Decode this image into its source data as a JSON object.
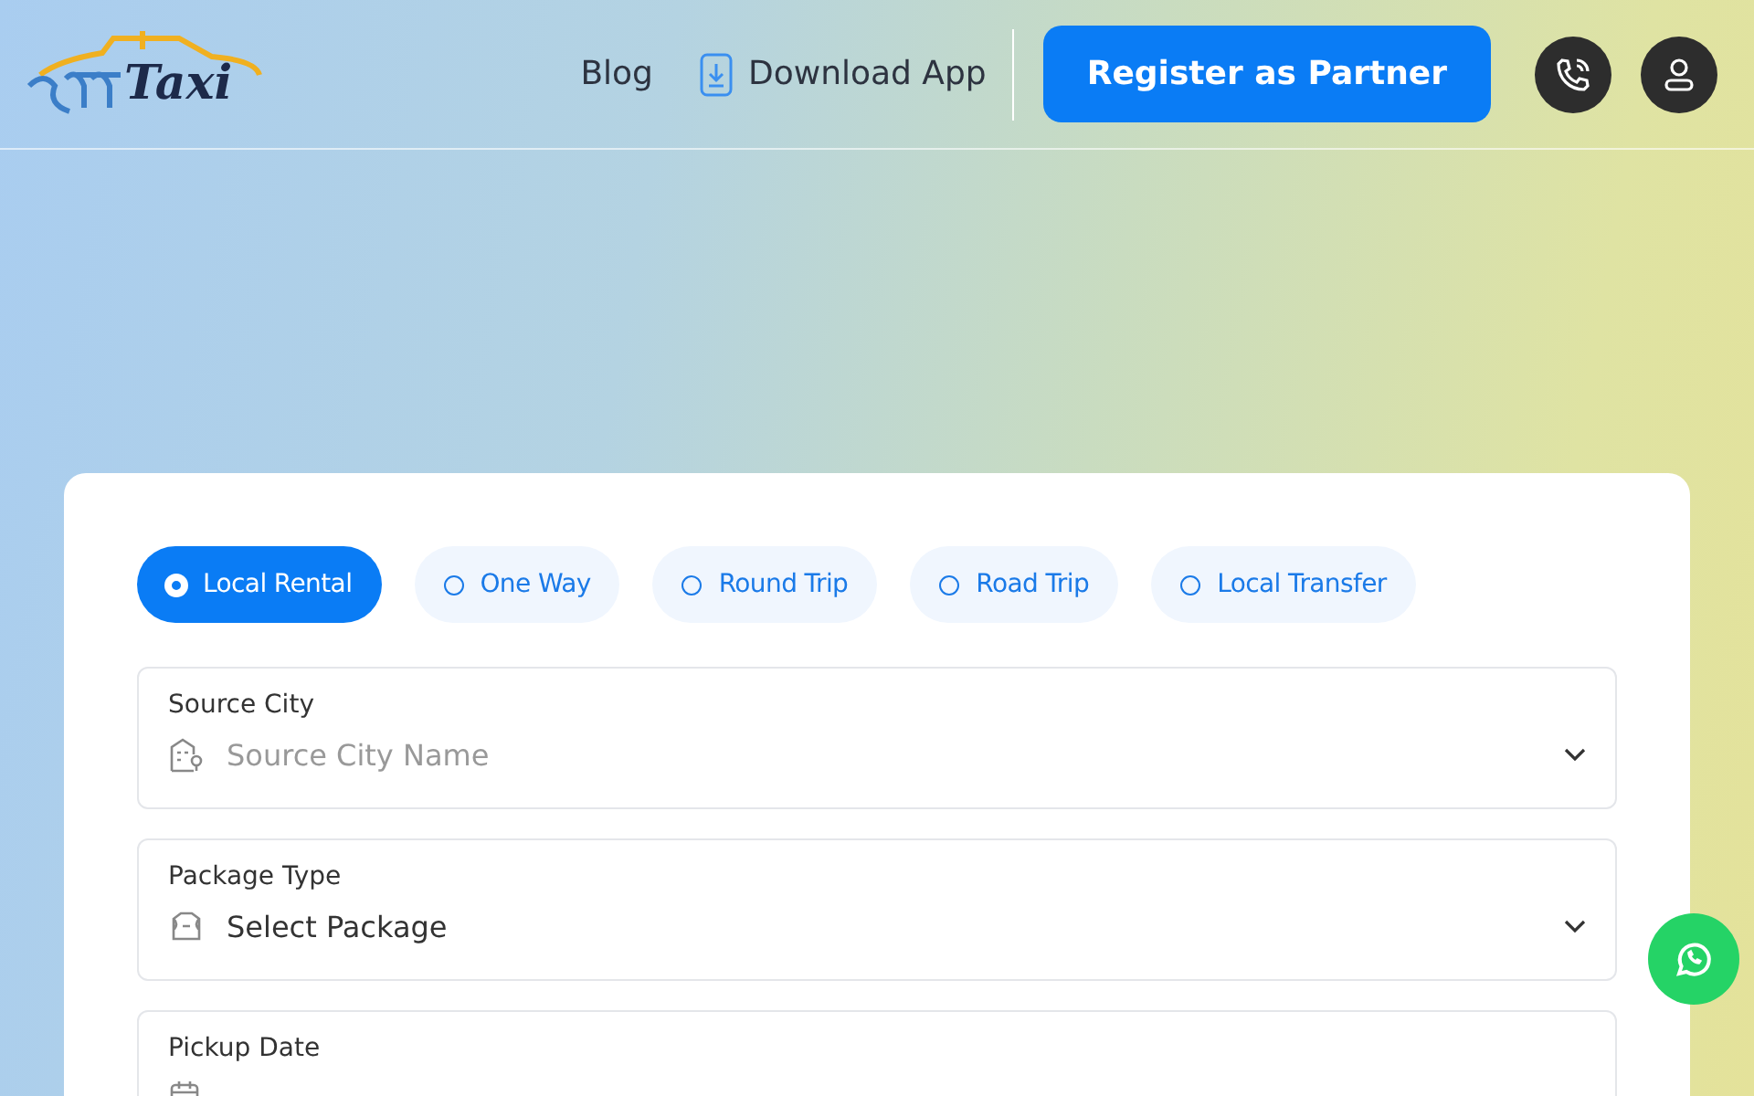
{
  "header": {
    "logo_text": "Taxi",
    "nav": [
      {
        "kind": "link",
        "label": "Blog"
      },
      {
        "kind": "app",
        "label": "Download App"
      }
    ],
    "cta": "Register as Partner"
  },
  "trip_types": [
    {
      "label": "Local Rental",
      "selected": true
    },
    {
      "label": "One Way",
      "selected": false
    },
    {
      "label": "Round Trip",
      "selected": false
    },
    {
      "label": "Road Trip",
      "selected": false
    },
    {
      "label": "Local Transfer",
      "selected": false
    }
  ],
  "fields": [
    {
      "kind": "city",
      "label": "Source City",
      "placeholder": "Source City Name"
    },
    {
      "kind": "package",
      "label": "Package Type",
      "value": "Select Package"
    },
    {
      "kind": "date",
      "label": "Pickup Date"
    }
  ]
}
